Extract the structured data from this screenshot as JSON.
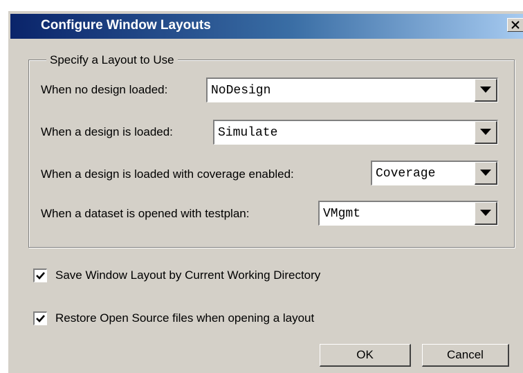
{
  "dialog": {
    "title": "Configure Window Layouts",
    "close_label": "X"
  },
  "group": {
    "legend": "Specify a Layout to Use",
    "rows": [
      {
        "label": "When no design loaded:",
        "value": "NoDesign"
      },
      {
        "label": "When a design is loaded:",
        "value": "Simulate"
      },
      {
        "label": "When a design is loaded with coverage enabled:",
        "value": "Coverage"
      },
      {
        "label": "When a dataset is opened with testplan:",
        "value": "VMgmt"
      }
    ]
  },
  "options": {
    "save_layout": {
      "label": "Save Window Layout by Current Working Directory",
      "checked": true
    },
    "restore_sources": {
      "label": "Restore Open Source files when opening a layout",
      "checked": true
    }
  },
  "buttons": {
    "ok": "OK",
    "cancel": "Cancel"
  },
  "colors": {
    "title_start": "#0a246a",
    "title_end": "#a6caf0",
    "face": "#d4d0c8"
  }
}
